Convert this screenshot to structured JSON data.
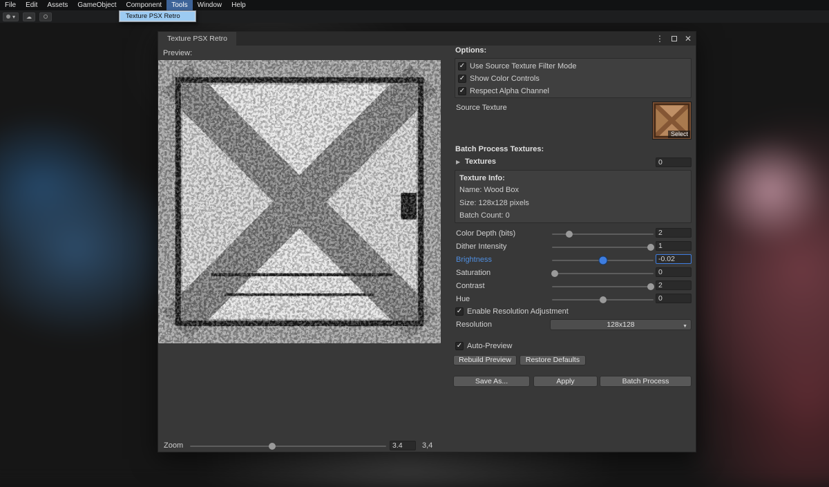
{
  "menu_bar": {
    "items": [
      "File",
      "Edit",
      "Assets",
      "GameObject",
      "Component",
      "Tools",
      "Window",
      "Help"
    ],
    "open_menu": "Tools",
    "dropdown_item": "Texture PSX Retro"
  },
  "icons": {
    "check": "✓",
    "foldout_arrow": "▶",
    "dropdown_arrow": "▼",
    "kebab": "⋮",
    "close": "✕",
    "caret_down": "▾",
    "cloud": "☁"
  },
  "colors": {
    "accent_blue": "#4f8ee0",
    "menu_highlight": "#9ccbf2",
    "window_bg": "#383838"
  },
  "window": {
    "tab_title": "Texture PSX Retro",
    "preview_label": "Preview:",
    "zoom": {
      "label": "Zoom",
      "value": "3.4",
      "display": "3,4",
      "pos": 42
    },
    "options": {
      "header": "Options:",
      "checkboxes": [
        {
          "label": "Use Source Texture Filter Mode",
          "checked": true
        },
        {
          "label": "Show Color Controls",
          "checked": true
        },
        {
          "label": "Respect Alpha Channel",
          "checked": true
        }
      ]
    },
    "source_texture": {
      "label": "Source Texture",
      "select_label": "Select"
    },
    "batch": {
      "header": "Batch Process Textures:",
      "foldout": "Textures",
      "count": "0"
    },
    "texture_info": {
      "header": "Texture Info:",
      "rows": [
        "Name: Wood Box",
        "Size: 128x128 pixels",
        "Batch Count: 0"
      ]
    },
    "sliders": [
      {
        "label": "Color Depth (bits)",
        "value": "2",
        "pos": 17,
        "active": false
      },
      {
        "label": "Dither Intensity",
        "value": "1",
        "pos": 97,
        "active": false
      },
      {
        "label": "Brightness",
        "value": "-0.02",
        "pos": 50,
        "active": true
      },
      {
        "label": "Saturation",
        "value": "0",
        "pos": 3,
        "active": false
      },
      {
        "label": "Contrast",
        "value": "2",
        "pos": 97,
        "active": false
      },
      {
        "label": "Hue",
        "value": "0",
        "pos": 50,
        "active": false
      }
    ],
    "resolution": {
      "checkbox_label": "Enable Resolution Adjustment",
      "label": "Resolution",
      "value": "128x128"
    },
    "auto_preview_label": "Auto-Preview",
    "buttons": {
      "rebuild": "Rebuild Preview",
      "restore": "Restore Defaults",
      "save_as": "Save As...",
      "apply": "Apply",
      "batch_process": "Batch Process"
    }
  }
}
